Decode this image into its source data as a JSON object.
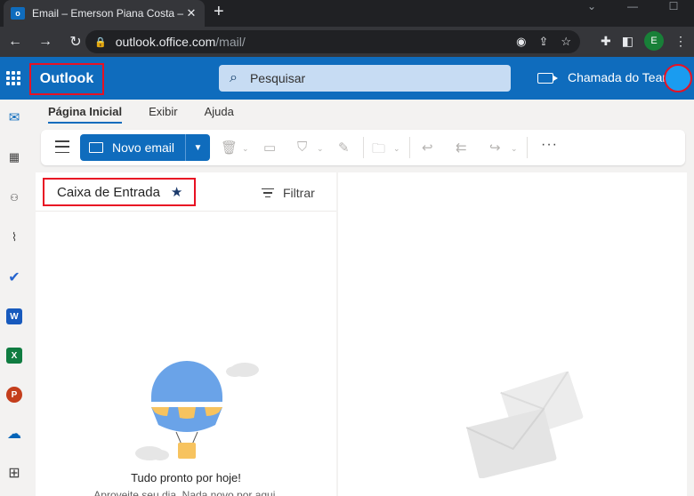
{
  "browser": {
    "tab_title": "Email – Emerson Piana Costa – O",
    "tab_favicon": "o",
    "tab_close": "✕",
    "new_tab": "+",
    "url_host": "outlook.office.com",
    "url_path": "/mail/",
    "profile_initial": "E"
  },
  "header": {
    "brand": "Outlook",
    "search_placeholder": "Pesquisar",
    "call_label": "Chamada do Tear",
    "accent": "#0f6cbd"
  },
  "ribbon": {
    "tabs": [
      {
        "label": "Página Inicial",
        "active": true
      },
      {
        "label": "Exibir",
        "active": false
      },
      {
        "label": "Ajuda",
        "active": false
      }
    ],
    "new_email_label": "Novo email",
    "more_label": "···"
  },
  "rail": {
    "apps": [
      {
        "name": "mail-icon",
        "glyph": "✉"
      },
      {
        "name": "calendar-icon",
        "glyph": "▦"
      },
      {
        "name": "people-icon",
        "glyph": "👥"
      },
      {
        "name": "attachment-icon",
        "glyph": "📎"
      },
      {
        "name": "todo-icon",
        "glyph": "✔"
      },
      {
        "name": "word-icon",
        "glyph": "W"
      },
      {
        "name": "excel-icon",
        "glyph": "X"
      },
      {
        "name": "powerpoint-icon",
        "glyph": "P"
      },
      {
        "name": "onedrive-icon",
        "glyph": "☁"
      },
      {
        "name": "more-apps-icon",
        "glyph": "⊞"
      }
    ]
  },
  "folder": {
    "title": "Caixa de Entrada",
    "filter_label": "Filtrar",
    "empty_title": "Tudo pronto por hoje!",
    "empty_subtitle": "Aproveite seu dia. Nada novo por aqui."
  }
}
